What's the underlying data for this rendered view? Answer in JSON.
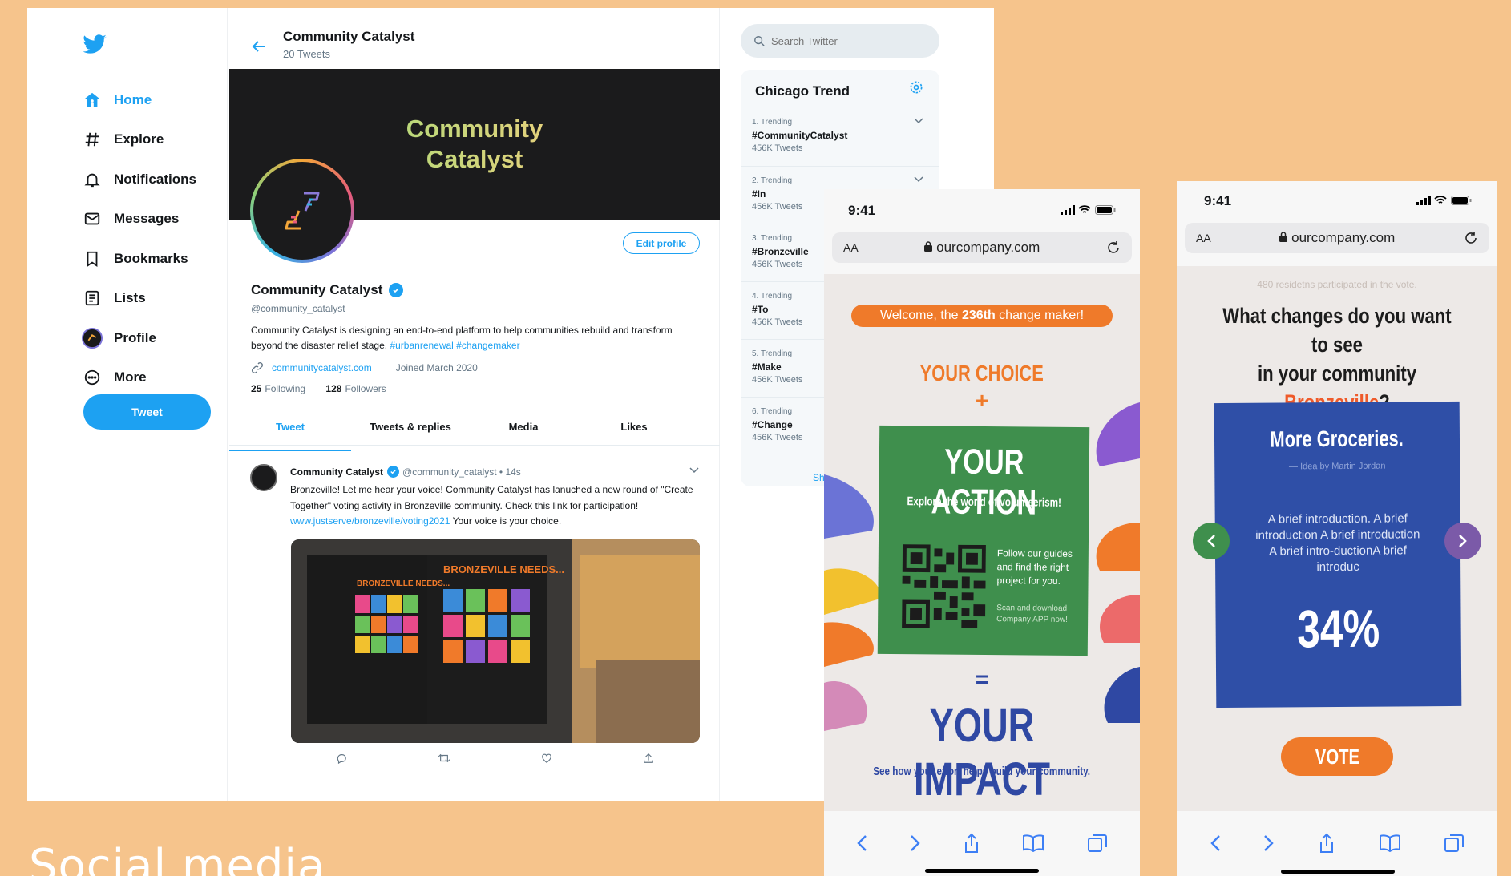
{
  "twitter": {
    "nav": [
      {
        "label": "Home",
        "icon": "home-icon"
      },
      {
        "label": "Explore",
        "icon": "hashtag-icon"
      },
      {
        "label": "Notifications",
        "icon": "bell-icon"
      },
      {
        "label": "Messages",
        "icon": "mail-icon"
      },
      {
        "label": "Bookmarks",
        "icon": "bookmark-icon"
      },
      {
        "label": "Lists",
        "icon": "list-icon"
      },
      {
        "label": "Profile",
        "icon": "avatar-icon"
      },
      {
        "label": "More",
        "icon": "more-icon"
      }
    ],
    "tweet_button": "Tweet",
    "profile": {
      "title": "Community Catalyst",
      "tweet_count": "20 Tweets",
      "banner_title_line1": "Community",
      "banner_title_line2": "Catalyst",
      "edit_profile": "Edit profile",
      "name": "Community Catalyst",
      "handle": "@community_catalyst",
      "bio": "Community Catalyst is designing an end-to-end platform to help communities rebuild and transform beyond the disaster relief stage.",
      "bio_tags": "#urbanrenewal #changemaker",
      "website": "communitycatalyst.com",
      "joined": "Joined March 2020",
      "following_count": "25",
      "following_label": "Following",
      "followers_count": "128",
      "followers_label": "Followers"
    },
    "tabs": [
      "Tweet",
      "Tweets & replies",
      "Media",
      "Likes"
    ],
    "tweet": {
      "author": "Community Catalyst",
      "handle_time": "@community_catalyst • 14s",
      "text": "Bronzeville! Let me hear your voice! Community Catalyst has lanuched a new round of \"Create Together\" voting activity in Bronzeville community. Check this link for participation!",
      "link": "www.justserve/bronzeville/voting2021",
      "text_end": "Your voice is your choice.",
      "image_sign1": "BRONZEVILLE NEEDS...",
      "image_sign2": "BRONZEVILLE NEEDS..."
    },
    "search_placeholder": "Search Twitter",
    "trends_title": "Chicago Trend",
    "trends": [
      {
        "rank": "1. Trending",
        "tag": "#CommunityCatalyst",
        "count": "456K Tweets"
      },
      {
        "rank": "2. Trending",
        "tag": "#In",
        "count": "456K Tweets"
      },
      {
        "rank": "3. Trending",
        "tag": "#Bronzeville",
        "count": "456K Tweets"
      },
      {
        "rank": "4. Trending",
        "tag": "#To",
        "count": "456K Tweets"
      },
      {
        "rank": "5. Trending",
        "tag": "#Make",
        "count": "456K Tweets"
      },
      {
        "rank": "6. Trending",
        "tag": "#Change",
        "count": "456K Tweets"
      }
    ],
    "show_more": "Sh"
  },
  "phone1": {
    "time": "9:41",
    "aa": "AA",
    "url": "ourcompany.com",
    "welcome_pre": "Welcome, the ",
    "welcome_bold": "236th",
    "welcome_post": " change maker!",
    "your_choice": "YOUR CHOICE",
    "plus": "+",
    "your_action": "YOUR ACTION",
    "action_sub": "Explore the world of volunteerism!",
    "guide_text": "Follow our guides and find the right project for you.",
    "scan_text": "Scan and download Company APP now!",
    "equals": "=",
    "your_impact": "YOUR IMPACT",
    "impact_sub": "See how your effort helps build your community."
  },
  "phone2": {
    "time": "9:41",
    "aa": "AA",
    "url": "ourcompany.com",
    "residents": "480 residetns participated in the vote.",
    "question_line1": "What changes do you want to see",
    "question_line2_pre": "in your community ",
    "question_highlight": "Bronzeville",
    "question_end": "?",
    "card_title": "More Groceries.",
    "card_by": "— Idea by Martin Jordan",
    "card_intro": "A brief introduction. A brief introduction A brief introduction A brief intro-ductionA brief introduc",
    "card_percent": "34%",
    "vote": "VOTE"
  },
  "caption": "Social media",
  "colors": {
    "background": "#F6C48C",
    "twitter_blue": "#1DA1F2",
    "orange": "#EF7A2A",
    "green_card": "#3F8F4D",
    "blue_card": "#2F4FA7"
  }
}
